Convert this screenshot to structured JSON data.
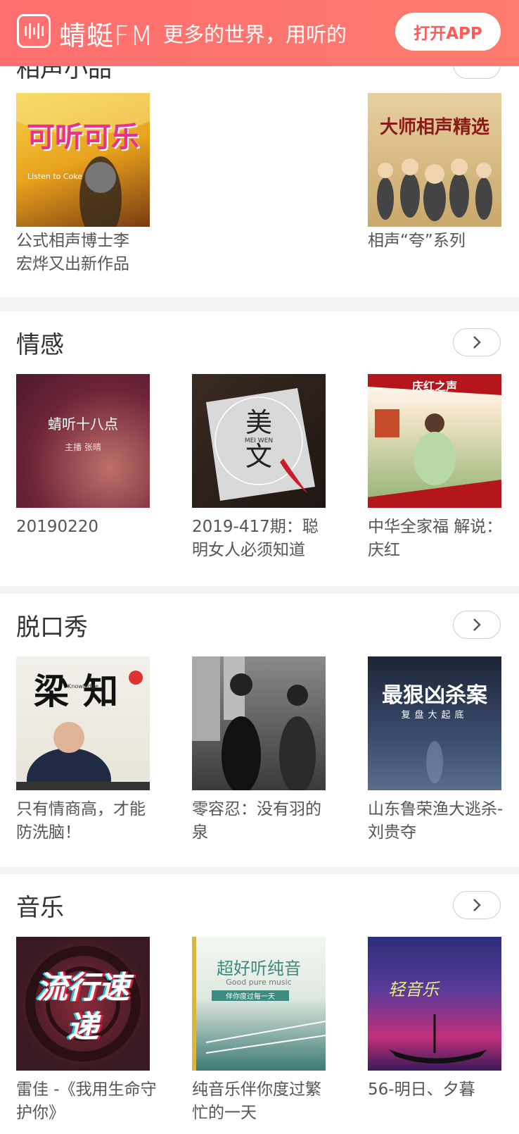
{
  "banner": {
    "logo_text": "蜻蜓FM",
    "slogan": "更多的世界，用听的",
    "open_app_label": "打开APP"
  },
  "sections": [
    {
      "title": "相声小品",
      "items": [
        {
          "caption": "公式相声博士李宏烨又出新作品",
          "cover_text": "可听可乐",
          "cover_sub": "Listen to Coke"
        },
        {
          "caption": "相声“夸”系列",
          "cover_text": "大师相声精选"
        }
      ]
    },
    {
      "title": "情感",
      "items": [
        {
          "caption": "20190220",
          "cover_text": "蜻听十八点",
          "cover_sub": "主播 张晴"
        },
        {
          "caption": "2019-417期：聪明女人必须知道",
          "cover_text": "美文",
          "cover_sub": "MEI WEN"
        },
        {
          "caption": "中华全家福 解说：庆红",
          "cover_text": "庆红之声"
        }
      ]
    },
    {
      "title": "脱口秀",
      "items": [
        {
          "caption": "只有情商高，才能防洗脑！",
          "cover_text": "梁知",
          "cover_sub": "Knowledge"
        },
        {
          "caption": "零容忍：没有羽的泉",
          "cover_text": ""
        },
        {
          "caption": "山东鲁荣渔大逃杀-刘贵夺",
          "cover_text": "最狠凶杀案",
          "cover_sub": "复盘大起底"
        }
      ]
    },
    {
      "title": "音乐",
      "items": [
        {
          "caption": "雷佳 -《我用生命守护你》",
          "cover_text": "流行速递"
        },
        {
          "caption": "纯音乐伴你度过繁忙的一天",
          "cover_text": "超好听纯音",
          "cover_sub": "Good pure music",
          "cover_sub2": "伴你度过每一天"
        },
        {
          "caption": "56-明日、夕暮",
          "cover_text": "轻音乐"
        }
      ]
    }
  ],
  "colors": {
    "brand": "#ff6f6f",
    "divider": "#f3f3f5",
    "caption": "#555555"
  }
}
